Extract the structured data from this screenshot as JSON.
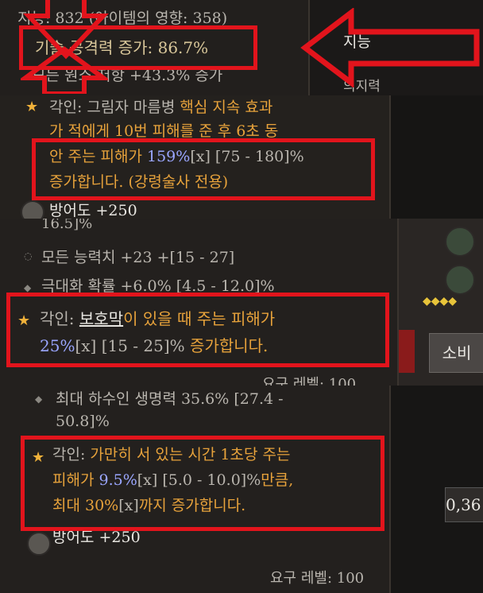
{
  "top": {
    "partial_stat": "지능: 832 (아이템의 영향: 358)",
    "skill_attack": "기술 공격력 증가: 86.7%",
    "resist_partial": "모든 원소 저항 +43.3% 증가",
    "side_label_1": "지능",
    "side_label_2": "의지력"
  },
  "panel1": {
    "aspect_label": "각인:",
    "aspect_line1": "그림자 마름병",
    "aspect_line1_orange": "핵심 지속 효과",
    "aspect_line2": "가 적에게 10번 피해를 준 후 6초 동",
    "aspect_line3_a": "안 주는 피해가 ",
    "aspect_line3_value": "159%",
    "aspect_line3_b": "[x] [75 - 180]%",
    "aspect_line4": "증가합니다. (강령술사 전용)",
    "armor": "방어도 +250"
  },
  "panel2": {
    "partial_prev": "16.5]%",
    "stat1": "모든 능력치 +23 +[15 - 27]",
    "stat2": "극대화 확률 +6.0% [4.5 - 12.0]%",
    "aspect_label": "각인:",
    "barrier": "보호막",
    "aspect_a": "이 있을 때 주는 피해가",
    "aspect_value": "25%",
    "aspect_b": "[x] [15 - 25]%",
    "aspect_c": " 증가합니다.",
    "level_partial": "요구 레벨: 100",
    "side_button": "소비"
  },
  "panel3": {
    "stat1": "최대 하수인 생명력 35.6% [27.4 -",
    "stat1_cont": "50.8]%",
    "aspect_label": "각인:",
    "aspect_a": "가만히 서 있는 시간 1초당 주는",
    "aspect_b_prefix": "피해가 ",
    "aspect_value": "9.5%",
    "aspect_b_range": "[x] [5.0 - 10.0]%",
    "aspect_b_suffix": "만큼,",
    "aspect_c_prefix": "최대 30%",
    "aspect_c_bracket": "[x]",
    "aspect_c_suffix": "까지 증가합니다.",
    "armor": "방어도 +250",
    "level_partial": "요구 레벨: 100",
    "side_value": "0,36"
  },
  "colors": {
    "highlight_red": "#e2141c",
    "aspect_orange": "#e7a23b",
    "value_blue": "#9aa6ff"
  }
}
